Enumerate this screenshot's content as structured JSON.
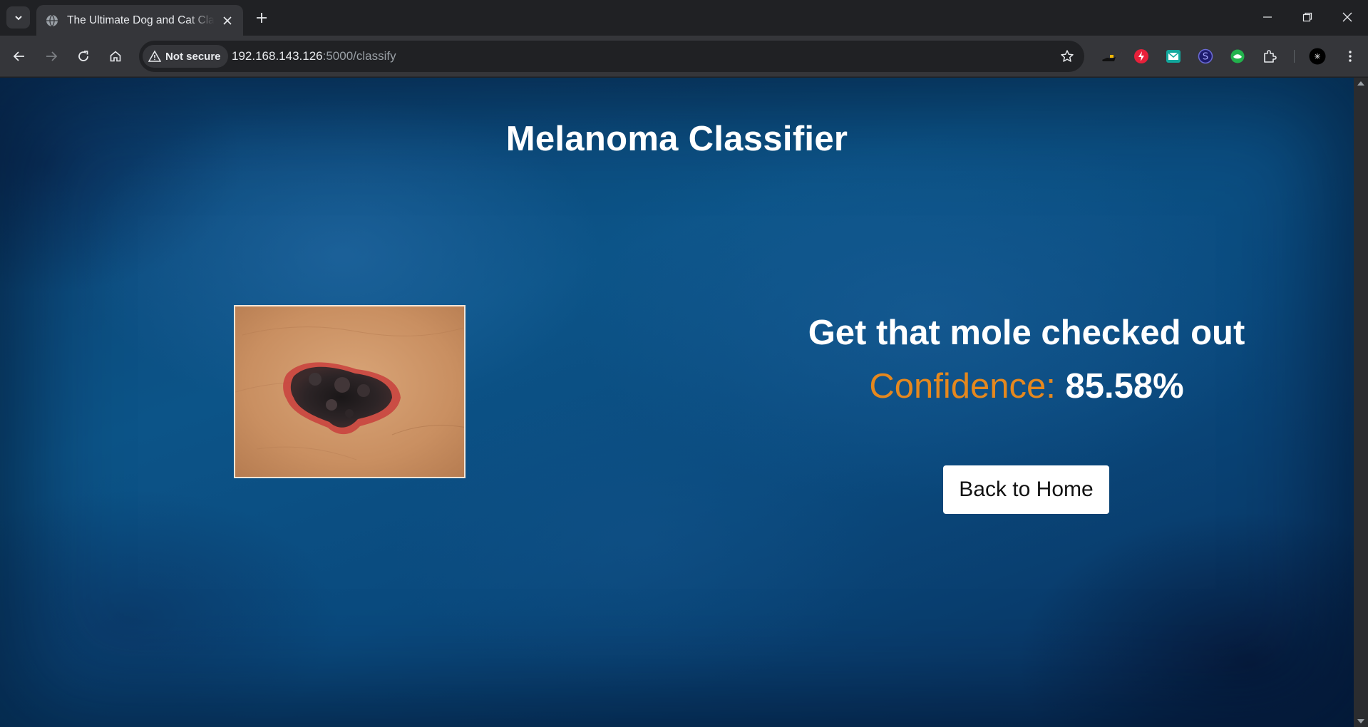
{
  "browser": {
    "tab": {
      "title": "The Ultimate Dog and Cat Classifier"
    },
    "address_bar": {
      "security_label": "Not secure",
      "url_host": "192.168.143.126",
      "url_path": ":5000/classify"
    }
  },
  "page": {
    "title": "Melanoma Classifier",
    "result": {
      "verdict": "Get that mole checked out",
      "confidence_label": "Confidence: ",
      "confidence_value": "85.58%"
    },
    "back_button_label": "Back to Home"
  },
  "colors": {
    "page_background": "#0c5488",
    "confidence_label": "#e5881e",
    "text": "#ffffff",
    "button_background": "#ffffff"
  },
  "icons": [
    "tab-search-icon",
    "globe-icon",
    "close-icon",
    "plus-icon",
    "minimize-icon",
    "restore-icon",
    "back-arrow-icon",
    "forward-arrow-icon",
    "reload-icon",
    "home-icon",
    "warning-icon",
    "star-icon",
    "extension-icon",
    "puzzle-icon",
    "profile-avatar",
    "more-vert-icon"
  ]
}
